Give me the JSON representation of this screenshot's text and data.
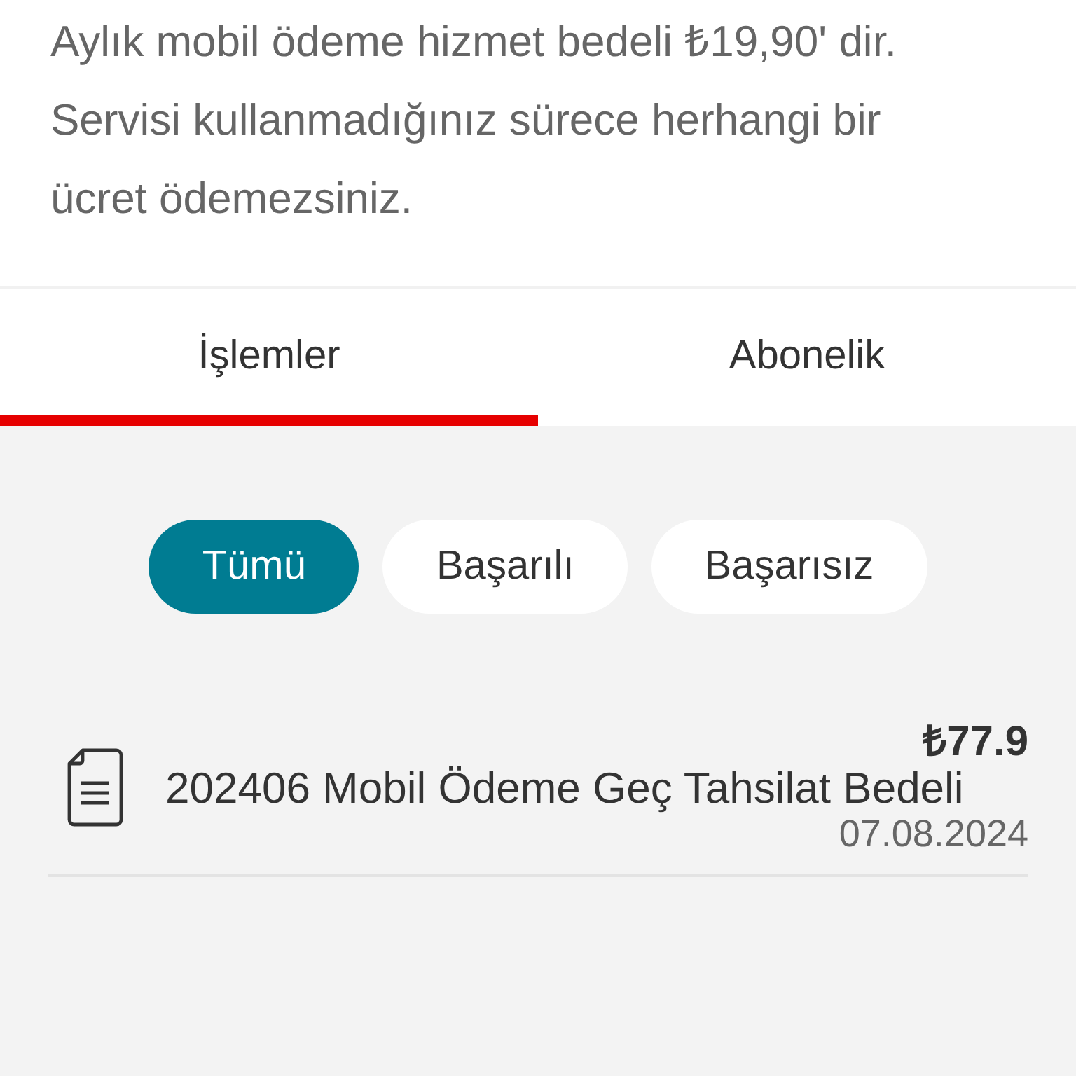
{
  "intro": {
    "text": "Aylık mobil ödeme hizmet bedeli ₺19,90' dir. Servisi kullanmadığınız sürece herhangi bir ücret ödemezsiniz."
  },
  "tabs": [
    {
      "label": "İşlemler",
      "selected": true
    },
    {
      "label": "Abonelik",
      "selected": false
    }
  ],
  "filters": [
    {
      "label": "Tümü",
      "selected": true
    },
    {
      "label": "Başarılı",
      "selected": false
    },
    {
      "label": "Başarısız",
      "selected": false
    }
  ],
  "transactions": [
    {
      "title": "202406 Mobil Ödeme Geç Tahsilat Bedeli",
      "amount": "₺77.9",
      "date": "07.08.2024"
    }
  ]
}
